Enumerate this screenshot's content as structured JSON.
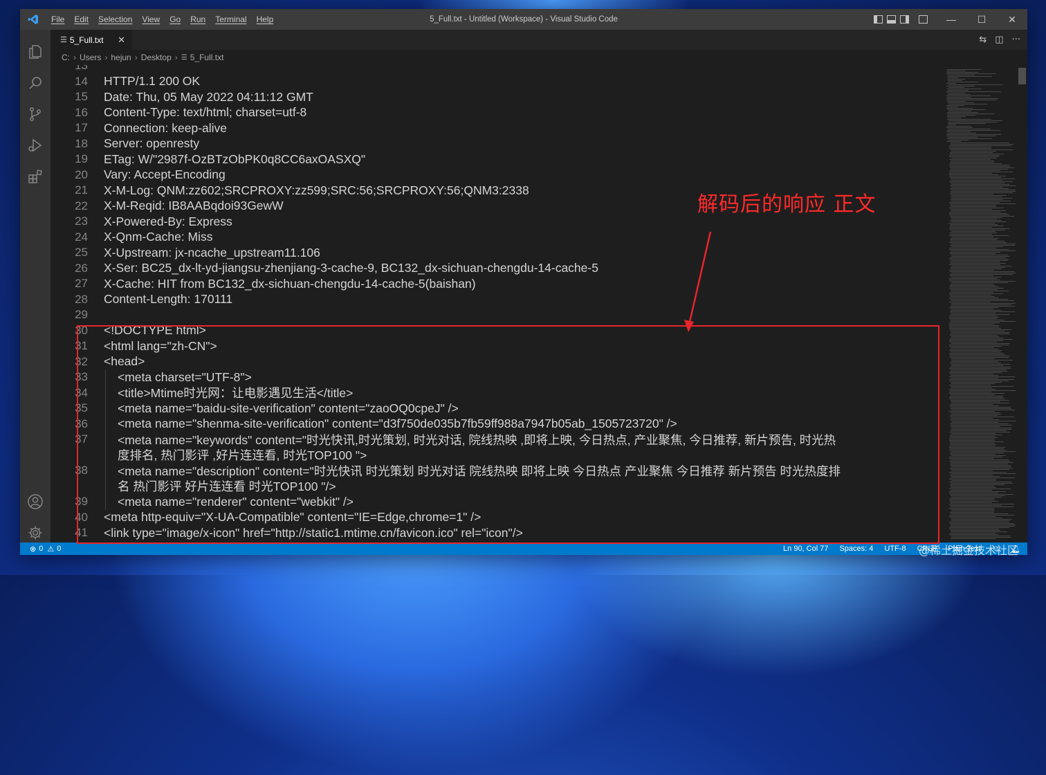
{
  "window": {
    "title": "5_Full.txt - Untitled (Workspace) - Visual Studio Code",
    "menu": [
      "File",
      "Edit",
      "Selection",
      "View",
      "Go",
      "Run",
      "Terminal",
      "Help"
    ]
  },
  "tabs": [
    {
      "label": "5_Full.txt",
      "icon": "lines-icon",
      "close": "✕"
    }
  ],
  "breadcrumb": [
    "C:",
    "Users",
    "hejun",
    "Desktop",
    "5_Full.txt"
  ],
  "editor": {
    "lines": [
      {
        "num": "13",
        "text": "",
        "indent": 0
      },
      {
        "num": "14",
        "text": "HTTP/1.1 200 OK",
        "indent": 0
      },
      {
        "num": "15",
        "text": "Date: Thu, 05 May 2022 04:11:12 GMT",
        "indent": 0
      },
      {
        "num": "16",
        "text": "Content-Type: text/html; charset=utf-8",
        "indent": 0
      },
      {
        "num": "17",
        "text": "Connection: keep-alive",
        "indent": 0
      },
      {
        "num": "18",
        "text": "Server: openresty",
        "indent": 0
      },
      {
        "num": "19",
        "text": "ETag: W/\"2987f-OzBTzObPK0q8CC6axOASXQ\"",
        "indent": 0
      },
      {
        "num": "20",
        "text": "Vary: Accept-Encoding",
        "indent": 0
      },
      {
        "num": "21",
        "text": "X-M-Log: QNM:zz602;SRCPROXY:zz599;SRC:56;SRCPROXY:56;QNM3:2338",
        "indent": 0
      },
      {
        "num": "22",
        "text": "X-M-Reqid: IB8AABqdoi93GewW",
        "indent": 0
      },
      {
        "num": "23",
        "text": "X-Powered-By: Express",
        "indent": 0
      },
      {
        "num": "24",
        "text": "X-Qnm-Cache: Miss",
        "indent": 0
      },
      {
        "num": "25",
        "text": "X-Upstream: jx-ncache_upstream11.106",
        "indent": 0
      },
      {
        "num": "26",
        "text": "X-Ser: BC25_dx-lt-yd-jiangsu-zhenjiang-3-cache-9, BC132_dx-sichuan-chengdu-14-cache-5",
        "indent": 0
      },
      {
        "num": "27",
        "text": "X-Cache: HIT from BC132_dx-sichuan-chengdu-14-cache-5(baishan)",
        "indent": 0
      },
      {
        "num": "28",
        "text": "Content-Length: 170111",
        "indent": 0
      },
      {
        "num": "29",
        "text": "",
        "indent": 0
      },
      {
        "num": "30",
        "text": "<!DOCTYPE html>",
        "indent": 0
      },
      {
        "num": "31",
        "text": "<html lang=\"zh-CN\">",
        "indent": 0
      },
      {
        "num": "32",
        "text": "<head>",
        "indent": 0
      },
      {
        "num": "33",
        "text": "<meta charset=\"UTF-8\">",
        "indent": 1
      },
      {
        "num": "34",
        "text": "<title>Mtime时光网：让电影遇见生活</title>",
        "indent": 1
      },
      {
        "num": "35",
        "text": "<meta name=\"baidu-site-verification\" content=\"zaoOQ0cpeJ\" />",
        "indent": 1
      },
      {
        "num": "36",
        "text": "<meta name=\"shenma-site-verification\" content=\"d3f750de035b7fb59ff988a7947b05ab_1505723720\" />",
        "indent": 1
      },
      {
        "num": "37",
        "text": "<meta name=\"keywords\" content=\"时光快讯,时光策划, 时光对话, 院线热映 ,即将上映, 今日热点, 产业聚焦, 今日推荐, 新片预告, 时光热",
        "indent": 1
      },
      {
        "num": "",
        "text": "度排名, 热门影评 ,好片连连看, 时光TOP100 \">",
        "indent": 1
      },
      {
        "num": "38",
        "text": "<meta name=\"description\" content=\"时光快讯  时光策划 时光对话 院线热映 即将上映 今日热点 产业聚焦 今日推荐 新片预告 时光热度排",
        "indent": 1
      },
      {
        "num": "",
        "text": "名 热门影评 好片连连看 时光TOP100 \"/>",
        "indent": 1
      },
      {
        "num": "39",
        "text": "<meta name=\"renderer\" content=\"webkit\" />",
        "indent": 1
      },
      {
        "num": "40",
        "text": "<meta http-equiv=\"X-UA-Compatible\" content=\"IE=Edge,chrome=1\" />",
        "indent": 0
      },
      {
        "num": "41",
        "text": "<link type=\"image/x-icon\" href=\"http://static1.mtime.cn/favicon.ico\" rel=\"icon\"/>",
        "indent": 0
      }
    ]
  },
  "statusbar": {
    "errors": "0",
    "warnings": "0",
    "position": "Ln 90, Col 77",
    "spaces": "Spaces: 4",
    "encoding": "UTF-8",
    "eol": "CRLF",
    "language": "Plain Text"
  },
  "annotation": {
    "label": "解码后的响应 正文",
    "color": "#e8252b"
  },
  "watermark": "@稀土掘金技术社区",
  "colors": {
    "titlebar": "#3c3c3c",
    "activitybar": "#333333",
    "editor_bg": "#1e1e1e",
    "statusbar": "#007acc",
    "text": "#d4d4d4",
    "line_number": "#858585"
  }
}
